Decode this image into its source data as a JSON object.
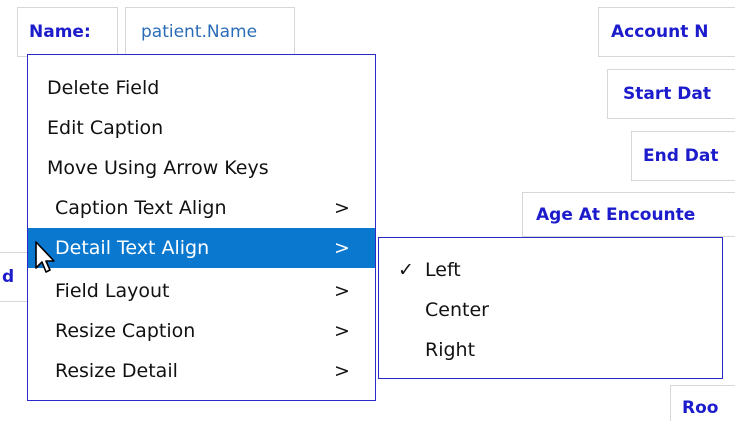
{
  "form": {
    "name_caption": "Name:",
    "name_detail": "patient.Name",
    "account_caption": "Account N",
    "start_caption": "Start Dat",
    "end_caption": "End Dat",
    "age_caption": "Age At Encounte",
    "room_caption": "Roo",
    "left_fragment": "d"
  },
  "context_menu": {
    "items": [
      {
        "label": "Delete Field",
        "arrow": ""
      },
      {
        "label": "Edit Caption",
        "arrow": ""
      },
      {
        "label": "Move Using Arrow Keys",
        "arrow": ""
      },
      {
        "label": "Caption Text Align",
        "arrow": ">"
      },
      {
        "label": "Detail Text Align",
        "arrow": ">"
      },
      {
        "label": "Field Layout",
        "arrow": ">"
      },
      {
        "label": "Resize Caption",
        "arrow": ">"
      },
      {
        "label": "Resize Detail",
        "arrow": ">"
      }
    ],
    "highlighted_index": 4
  },
  "submenu": {
    "items": [
      {
        "label": "Left",
        "checked": "✓"
      },
      {
        "label": "Center",
        "checked": ""
      },
      {
        "label": "Right",
        "checked": ""
      }
    ]
  },
  "colors": {
    "caption": "#1c1ccc",
    "detail": "#2b6cb8",
    "highlight": "#0b78d0",
    "menu_border": "#2a2ac8"
  },
  "icons": {
    "cursor": "mouse-pointer-icon",
    "check": "checkmark-icon"
  }
}
